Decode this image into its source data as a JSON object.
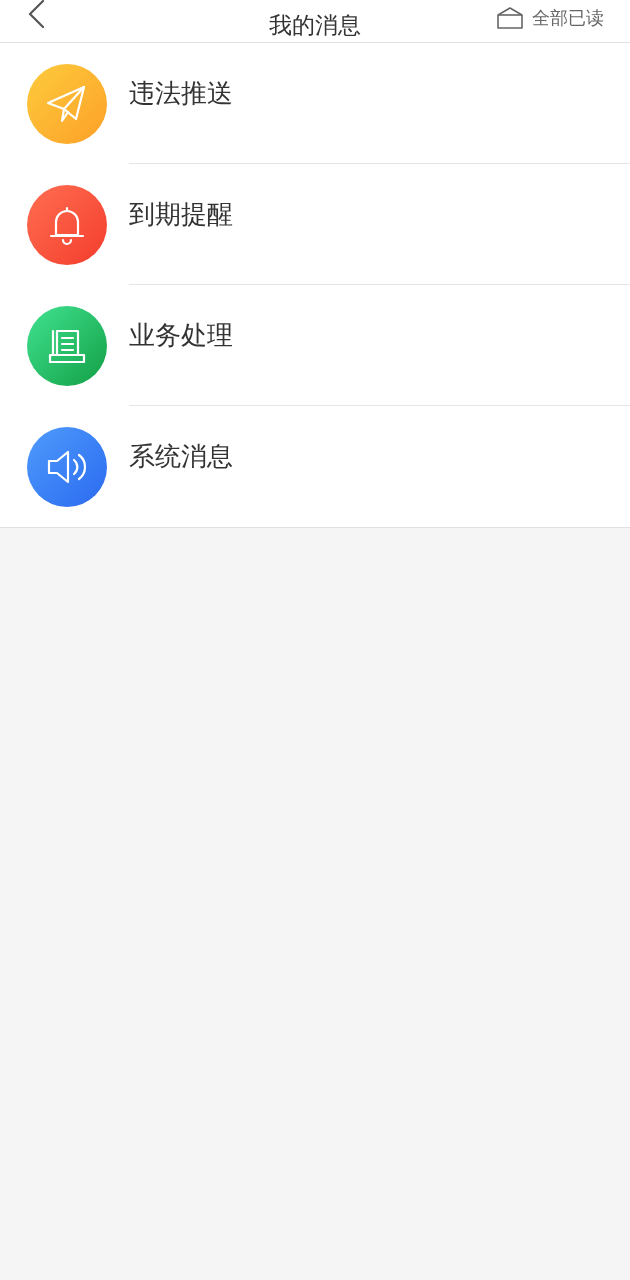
{
  "header": {
    "title": "我的消息",
    "action": "全部已读"
  },
  "items": [
    {
      "kind": "plane",
      "label": "违法推送"
    },
    {
      "kind": "bell",
      "label": "到期提醒"
    },
    {
      "kind": "doc",
      "label": "业务处理"
    },
    {
      "kind": "speaker",
      "label": "系统消息"
    }
  ]
}
